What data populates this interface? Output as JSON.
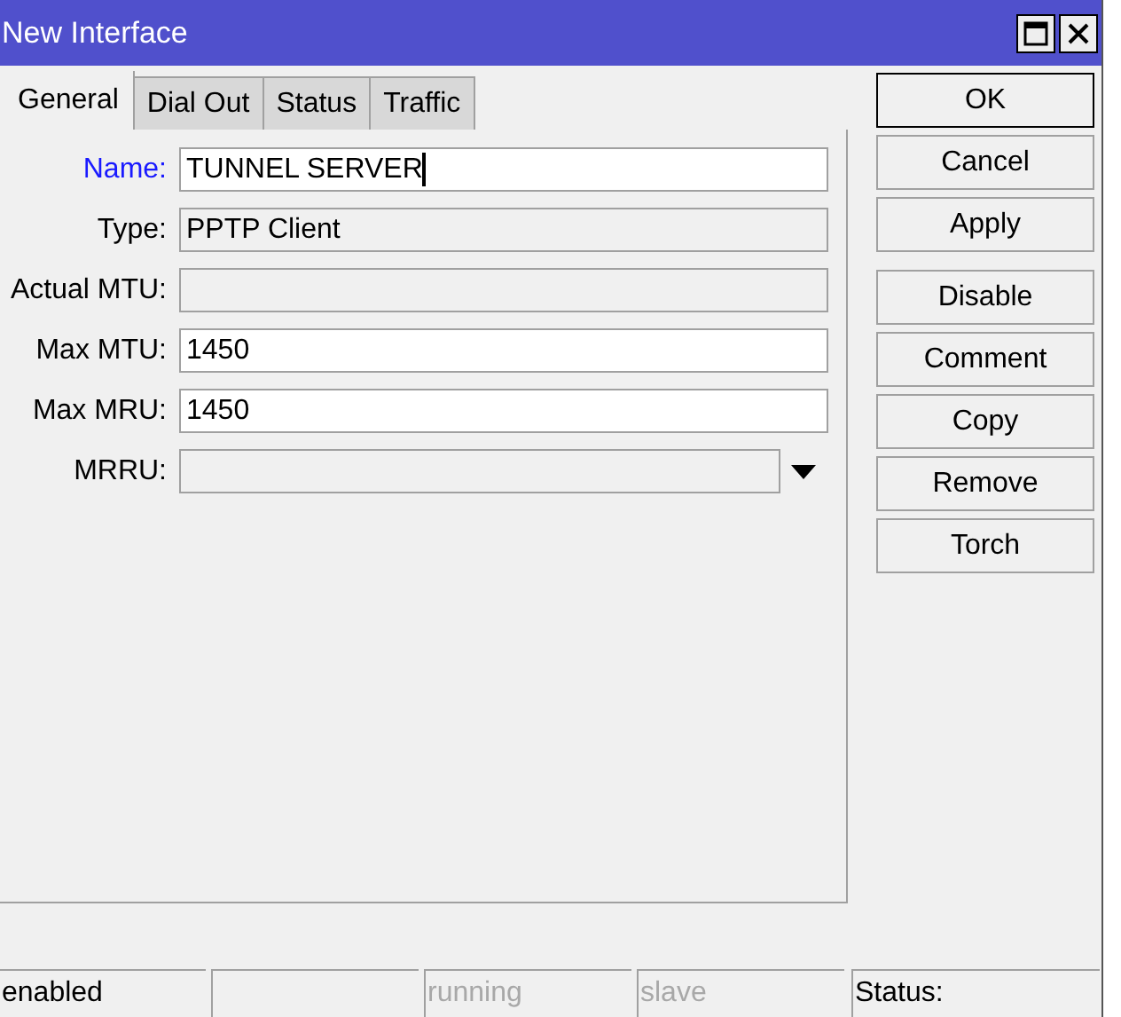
{
  "window": {
    "title": "New Interface"
  },
  "tabs": [
    {
      "label": "General",
      "selected": true
    },
    {
      "label": "Dial Out",
      "selected": false
    },
    {
      "label": "Status",
      "selected": false
    },
    {
      "label": "Traffic",
      "selected": false
    }
  ],
  "fields": [
    {
      "label": "Name:",
      "value": "TUNNEL SERVER",
      "focused": true,
      "disabled": false,
      "kind": "text"
    },
    {
      "label": "Type:",
      "value": "PPTP Client",
      "focused": false,
      "disabled": true,
      "kind": "text"
    },
    {
      "label": "Actual MTU:",
      "focused": false,
      "disabled": true,
      "kind": "text"
    },
    {
      "label": "Max MTU:",
      "value": "1450",
      "focused": false,
      "disabled": false,
      "kind": "text"
    },
    {
      "label": "Max MRU:",
      "value": "1450",
      "focused": false,
      "disabled": false,
      "kind": "text"
    },
    {
      "label": "MRRU:",
      "focused": false,
      "disabled": true,
      "kind": "dropdown"
    }
  ],
  "button_groups": [
    [
      {
        "label": "OK",
        "default": true
      },
      {
        "label": "Cancel",
        "default": false
      },
      {
        "label": "Apply",
        "default": false
      }
    ],
    [
      {
        "label": "Disable",
        "default": false
      },
      {
        "label": "Comment",
        "default": false
      },
      {
        "label": "Copy",
        "default": false
      },
      {
        "label": "Remove",
        "default": false
      },
      {
        "label": "Torch",
        "default": false
      }
    ]
  ],
  "status_bar": [
    {
      "kind": "text",
      "text": "enabled",
      "dimmed": false
    },
    {
      "kind": "blank"
    },
    {
      "kind": "text",
      "text": "running",
      "dimmed": true
    },
    {
      "kind": "text",
      "text": "slave",
      "dimmed": true
    },
    {
      "kind": "text",
      "text": "Status:",
      "dimmed": false
    }
  ]
}
